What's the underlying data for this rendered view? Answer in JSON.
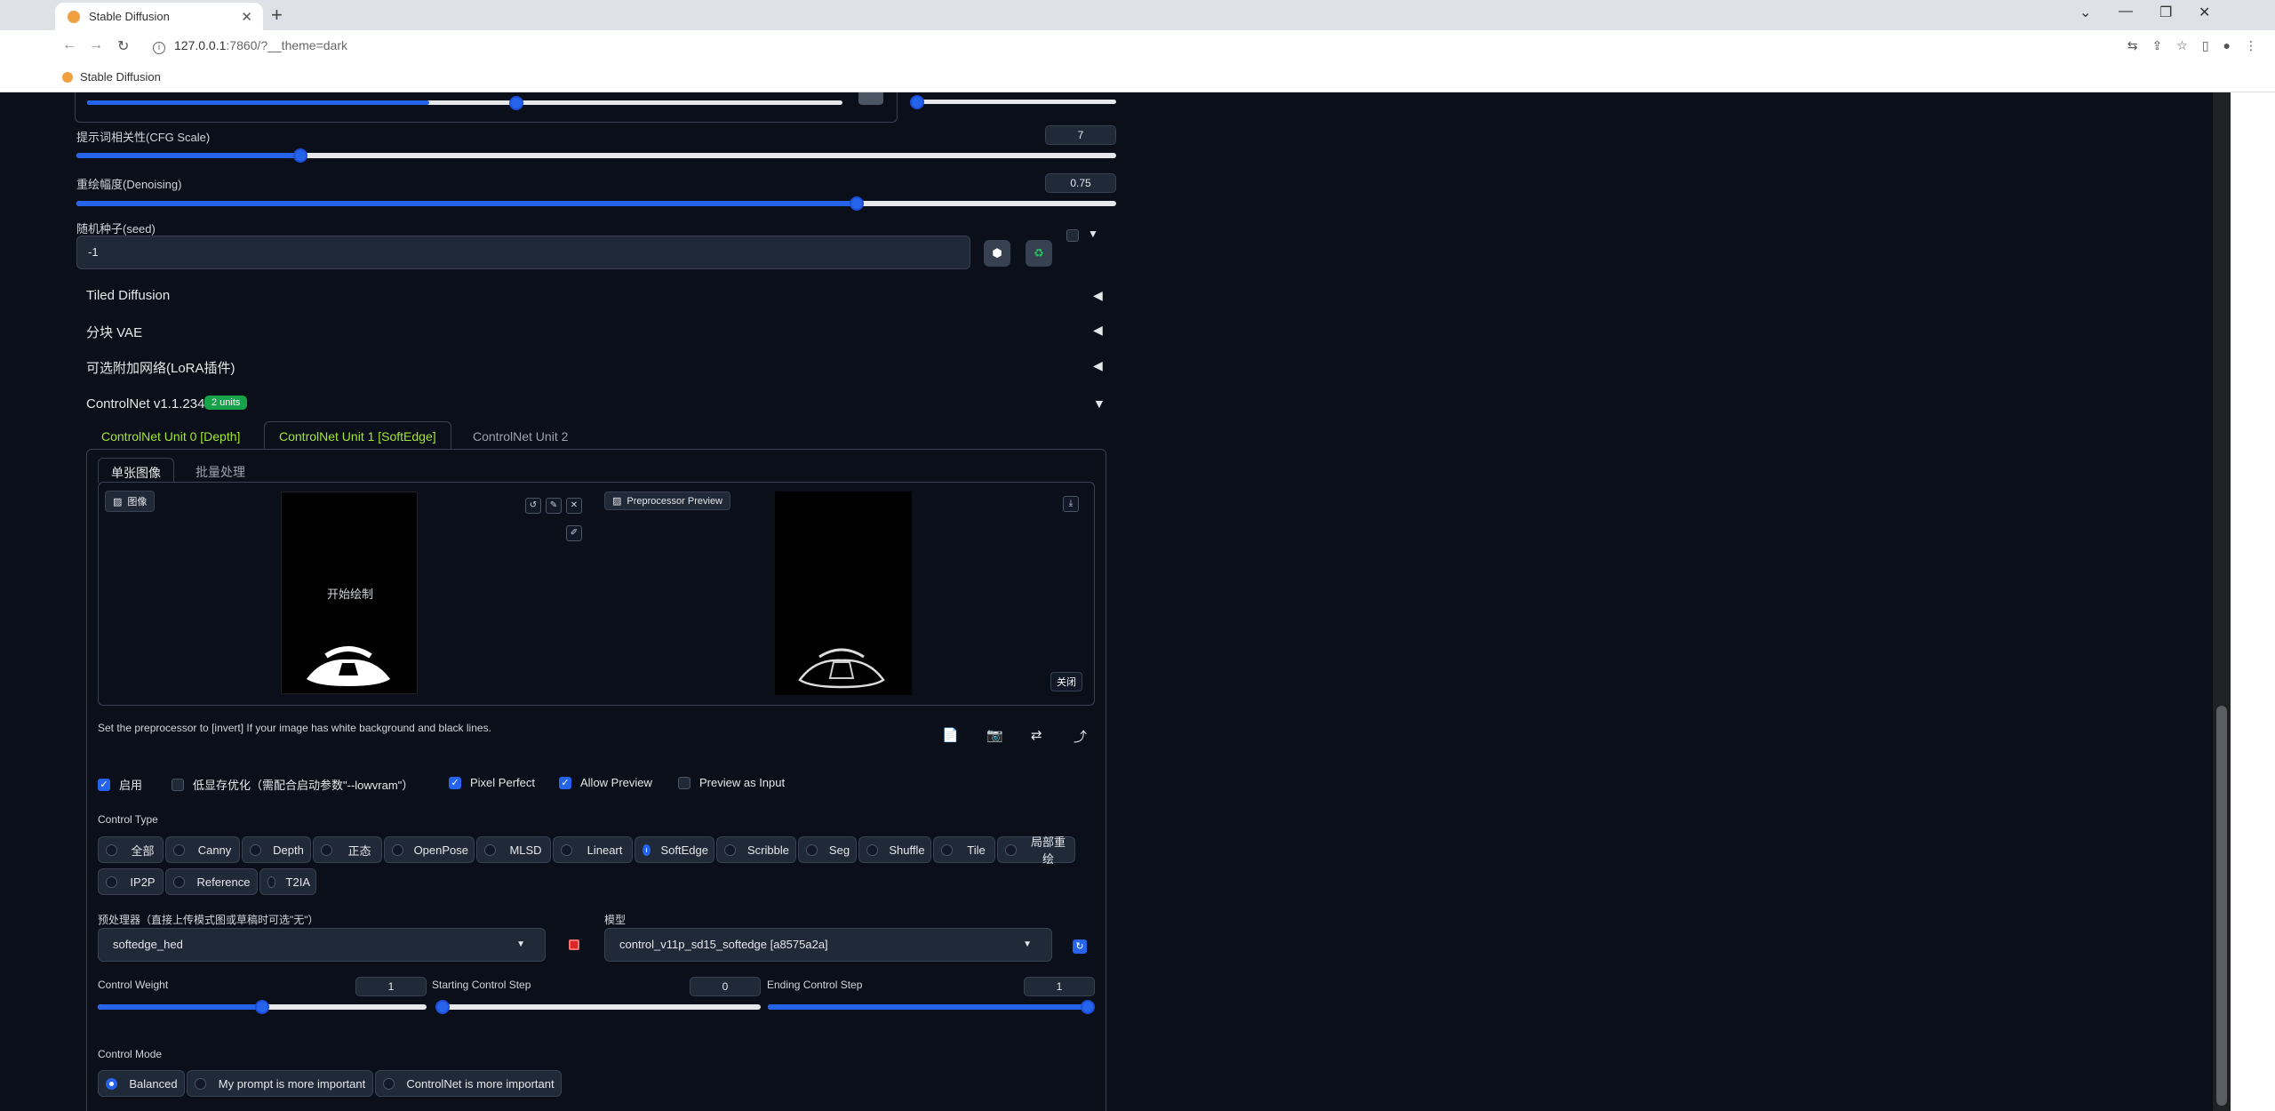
{
  "browser": {
    "tab_title": "Stable Diffusion",
    "url_main": "127.0.0.1",
    "url_rest": ":7860/?__theme=dark",
    "bookmark": "Stable Diffusion"
  },
  "cfg": {
    "label": "提示词相关性(CFG Scale)",
    "value": "7",
    "fraction": 0.215
  },
  "denoise": {
    "label": "重绘幅度(Denoising)",
    "value": "0.75",
    "fraction": 0.75
  },
  "seed": {
    "label": "随机种子(seed)",
    "value": "-1"
  },
  "accordions": {
    "tiled_diffusion": "Tiled Diffusion",
    "tiled_vae": "分块 VAE",
    "lora": "可选附加网络(LoRA插件)",
    "controlnet": "ControlNet v1.1.234",
    "units_badge": "2 units"
  },
  "unit_tabs": [
    "ControlNet Unit 0 [Depth]",
    "ControlNet Unit 1 [SoftEdge]",
    "ControlNet Unit 2"
  ],
  "image_tabs": {
    "single": "单张图像",
    "batch": "批量处理"
  },
  "image_label": "图像",
  "canvas_hint": "开始绘制",
  "preview_label": "Preprocessor Preview",
  "close_label": "关闭",
  "hint_text": "Set the preprocessor to [invert] If your image has white background and black lines.",
  "checks": {
    "enable": "启用",
    "lowvram": "低显存优化（需配合启动参数\"--lowvram\"）",
    "pixel_perfect": "Pixel Perfect",
    "allow_preview": "Allow Preview",
    "preview_input": "Preview as Input"
  },
  "control_type_label": "Control Type",
  "control_types_row1": [
    "全部",
    "Canny",
    "Depth",
    "正态",
    "OpenPose",
    "MLSD",
    "Lineart",
    "SoftEdge",
    "Scribble",
    "Seg",
    "Shuffle",
    "Tile",
    "局部重绘"
  ],
  "control_types_row2": [
    "IP2P",
    "Reference",
    "T2IA"
  ],
  "selected_control_type": "SoftEdge",
  "preprocessor": {
    "label": "预处理器（直接上传模式图或草稿时可选\"无\"）",
    "value": "softedge_hed"
  },
  "model": {
    "label": "模型",
    "value": "control_v11p_sd15_softedge [a8575a2a]"
  },
  "control_weight": {
    "label": "Control Weight",
    "value": "1",
    "fraction": 0.5
  },
  "start_step": {
    "label": "Starting Control Step",
    "value": "0",
    "fraction": 0
  },
  "end_step": {
    "label": "Ending Control Step",
    "value": "1",
    "fraction": 1
  },
  "control_mode": {
    "label": "Control Mode",
    "options": [
      "Balanced",
      "My prompt is more important",
      "ControlNet is more important"
    ],
    "selected": "Balanced"
  },
  "colors": {
    "accent": "#2563eb",
    "tab_active": "#a3e635",
    "badge": "#16a34a"
  }
}
